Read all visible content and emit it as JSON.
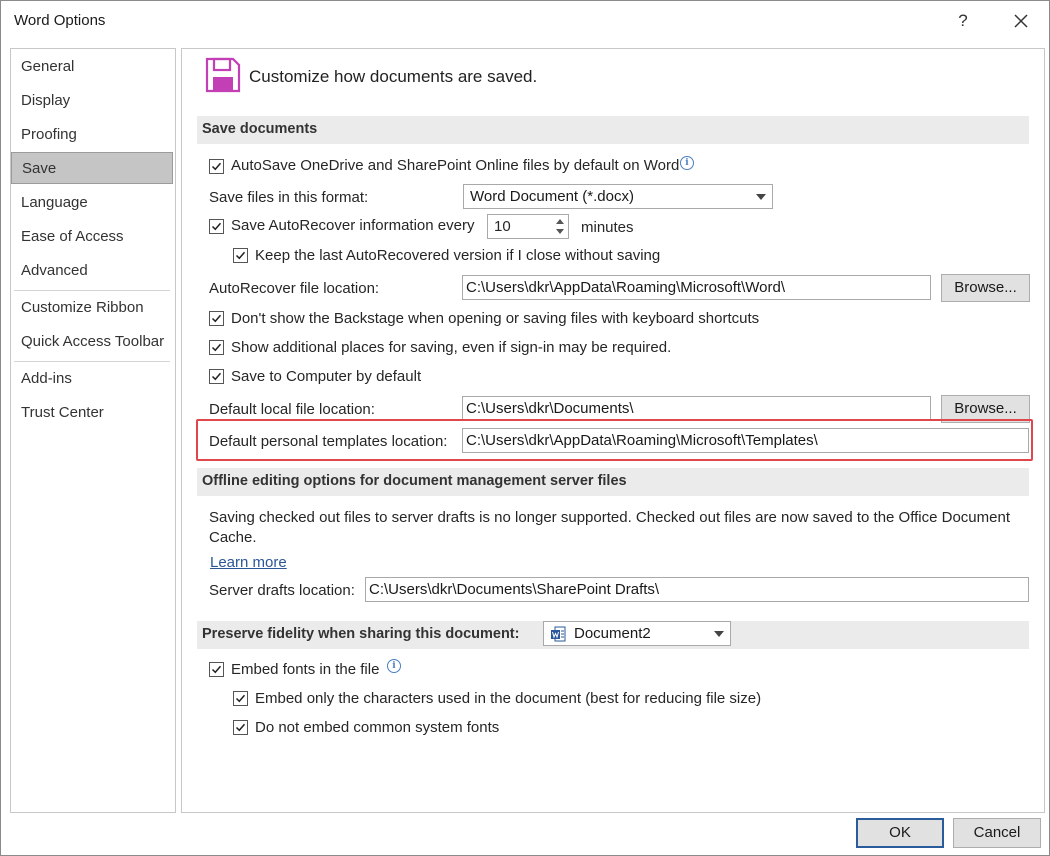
{
  "window": {
    "title": "Word Options",
    "help_label": "?"
  },
  "sidebar": {
    "items": [
      {
        "label": "General"
      },
      {
        "label": "Display"
      },
      {
        "label": "Proofing"
      },
      {
        "label": "Save",
        "selected": true
      },
      {
        "label": "Language"
      },
      {
        "label": "Ease of Access"
      },
      {
        "label": "Advanced"
      },
      {
        "label": "Customize Ribbon"
      },
      {
        "label": "Quick Access Toolbar"
      },
      {
        "label": "Add-ins"
      },
      {
        "label": "Trust Center"
      }
    ]
  },
  "main": {
    "header": "Customize how documents are saved.",
    "save_documents": {
      "title": "Save documents",
      "autosave_label": "AutoSave OneDrive and SharePoint Online files by default on Word",
      "autosave_checked": true,
      "format_label": "Save files in this format:",
      "format_value": "Word Document (*.docx)",
      "autorecover_label": "Save AutoRecover information every",
      "autorecover_checked": true,
      "autorecover_minutes": "10",
      "minutes_label": "minutes",
      "keep_last_label": "Keep the last AutoRecovered version if I close without saving",
      "keep_last_checked": true,
      "autorecover_location_label": "AutoRecover file location:",
      "autorecover_location_value": "C:\\Users\\dkr\\AppData\\Roaming\\Microsoft\\Word\\",
      "browse_label": "Browse...",
      "backstage_label": "Don't show the Backstage when opening or saving files with keyboard shortcuts",
      "backstage_checked": true,
      "additional_places_label": "Show additional places for saving, even if sign-in may be required.",
      "additional_places_checked": true,
      "save_to_computer_label": "Save to Computer by default",
      "save_to_computer_checked": true,
      "default_local_label": "Default local file location:",
      "default_local_value": "C:\\Users\\dkr\\Documents\\",
      "default_templates_label": "Default personal templates location:",
      "default_templates_value": "C:\\Users\\dkr\\AppData\\Roaming\\Microsoft\\Templates\\"
    },
    "offline": {
      "title": "Offline editing options for document management server files",
      "description": "Saving checked out files to server drafts is no longer supported. Checked out files are now saved to the Office Document Cache.",
      "learn_more": "Learn more",
      "server_drafts_label": "Server drafts location:",
      "server_drafts_value": "C:\\Users\\dkr\\Documents\\SharePoint Drafts\\"
    },
    "fidelity": {
      "title": "Preserve fidelity when sharing this document:",
      "document_value": "Document2",
      "embed_fonts_label": "Embed fonts in the file",
      "embed_fonts_checked": true,
      "embed_chars_label": "Embed only the characters used in the document (best for reducing file size)",
      "embed_chars_checked": true,
      "no_common_label": "Do not embed common system fonts",
      "no_common_checked": true
    }
  },
  "footer": {
    "ok_label": "OK",
    "cancel_label": "Cancel"
  },
  "colors": {
    "accent": "#2a5b9a",
    "save_icon": "#c23fb6",
    "highlight": "#e0474c",
    "link": "#2b5797"
  }
}
